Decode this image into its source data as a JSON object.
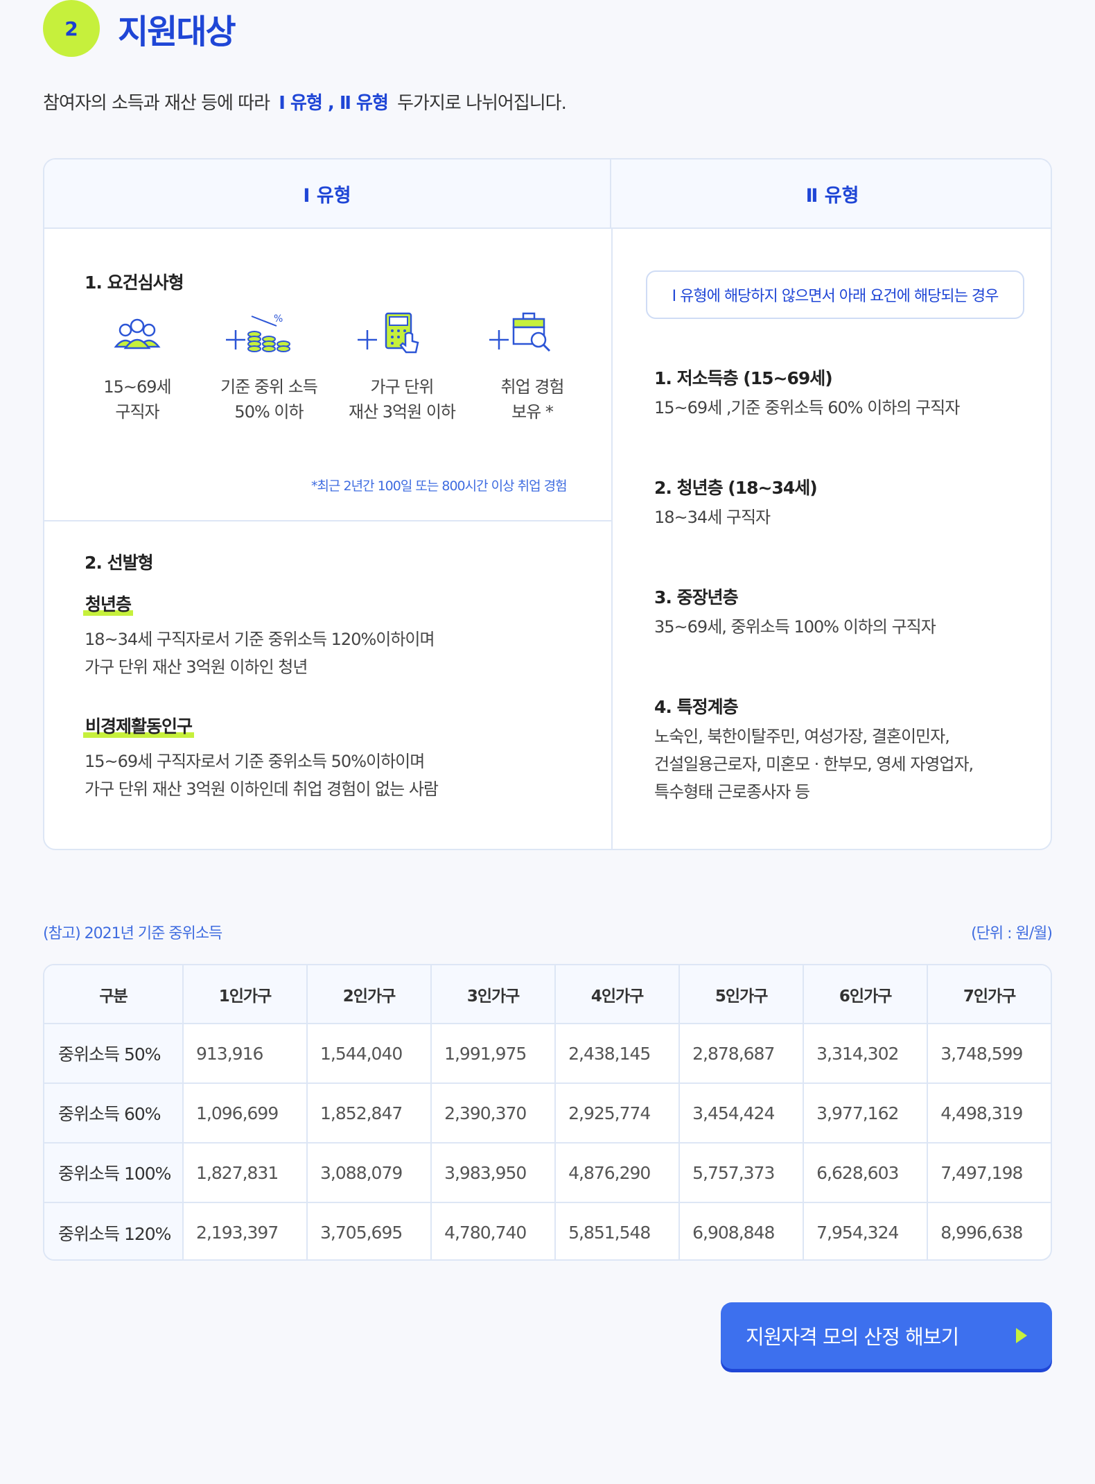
{
  "section": {
    "number": "2",
    "title": "지원대상"
  },
  "intro": {
    "before": "참여자의 소득과 재산 등에 따라",
    "types": "Ⅰ 유형 , Ⅱ 유형",
    "after": "두가지로 나뉘어집니다."
  },
  "type1": {
    "header": "Ⅰ 유형",
    "req": {
      "title": "1. 요건심사형",
      "items": [
        {
          "icon": "people-icon",
          "line1": "15~69세",
          "line2": "구직자"
        },
        {
          "icon": "coins-percent-icon",
          "line1": "기준 중위 소득",
          "line2": "50% 이하"
        },
        {
          "icon": "calculator-hand-icon",
          "line1": "가구 단위",
          "line2": "재산 3억원 이하"
        },
        {
          "icon": "briefcase-search-icon",
          "line1": "취업 경험",
          "line2": "보유 *"
        }
      ],
      "footnote": "*최근 2년간 100일 또는 800시간 이상 취업 경험"
    },
    "select": {
      "title": "2. 선발형",
      "youth": {
        "tag": "청년층",
        "line1": "18~34세 구직자로서 기준 중위소득 120%이하이며",
        "line2": "가구 단위 재산 3억원 이하인 청년"
      },
      "inactive": {
        "tag": "비경제활동인구",
        "line1": "15~69세 구직자로서 기준 중위소득 50%이하이며",
        "line2": "가구 단위 재산 3억원 이하인데 취업 경험이 없는 사람"
      }
    }
  },
  "type2": {
    "header": "Ⅱ 유형",
    "pill": "Ⅰ 유형에 해당하지 않으면서 아래 요건에 해당되는 경우",
    "items": [
      {
        "title": "1. 저소득층 (15~69세)",
        "lines": [
          "15~69세 ,기준 중위소득 60% 이하의 구직자"
        ]
      },
      {
        "title": "2. 청년층 (18~34세)",
        "lines": [
          "18~34세 구직자"
        ]
      },
      {
        "title": "3. 중장년층",
        "lines": [
          "35~69세, 중위소득 100% 이하의 구직자"
        ]
      },
      {
        "title": "4. 특정계층",
        "lines": [
          "노숙인, 북한이탈주민, 여성가장, 결혼이민자,",
          "건설일용근로자, 미혼모 · 한부모, 영세 자영업자,",
          "특수형태 근로종사자 등"
        ]
      }
    ]
  },
  "reference": {
    "title": "(참고) 2021년 기준 중위소득",
    "unit": "(단위 : 원/월)"
  },
  "table": {
    "headers": [
      "구분",
      "1인가구",
      "2인가구",
      "3인가구",
      "4인가구",
      "5인가구",
      "6인가구",
      "7인가구"
    ],
    "rows": [
      {
        "label": "중위소득 50%",
        "values": [
          "913,916",
          "1,544,040",
          "1,991,975",
          "2,438,145",
          "2,878,687",
          "3,314,302",
          "3,748,599"
        ]
      },
      {
        "label": "중위소득 60%",
        "values": [
          "1,096,699",
          "1,852,847",
          "2,390,370",
          "2,925,774",
          "3,454,424",
          "3,977,162",
          "4,498,319"
        ]
      },
      {
        "label": "중위소득 100%",
        "values": [
          "1,827,831",
          "3,088,079",
          "3,983,950",
          "4,876,290",
          "5,757,373",
          "6,628,603",
          "7,497,198"
        ]
      },
      {
        "label": "중위소득 120%",
        "values": [
          "2,193,397",
          "3,705,695",
          "4,780,740",
          "5,851,548",
          "6,908,848",
          "7,954,324",
          "8,996,638"
        ]
      }
    ]
  },
  "cta": {
    "label": "지원자격 모의 산정 해보기"
  },
  "colors": {
    "accent_blue": "#1f46d6",
    "lime": "#c6f03c",
    "button_blue": "#3d70ee"
  }
}
